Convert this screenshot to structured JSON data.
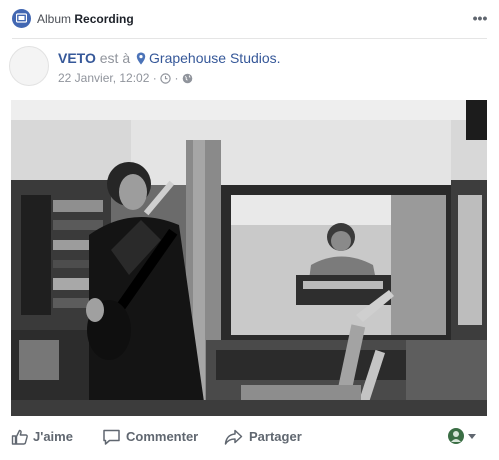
{
  "album": {
    "prefix": "Album",
    "name": "Recording"
  },
  "menu": {
    "more_icon": "more-horizontal-icon",
    "more_label": "•••"
  },
  "post": {
    "author": "VETO",
    "connector": "est à",
    "location_icon": "map-pin-icon",
    "location": "Grapehouse Studios.",
    "timestamp": "22 Janvier, 12:02",
    "separator": "·",
    "meta_icons": [
      "clock-icon",
      "globe-icon"
    ]
  },
  "photo": {
    "icon": "photo"
  },
  "actions": {
    "like": "J'aime",
    "comment": "Commenter",
    "share": "Partager"
  },
  "colors": {
    "brand": "#4267b2",
    "link": "#365899",
    "muted": "#90949c",
    "action_text": "#606770"
  }
}
